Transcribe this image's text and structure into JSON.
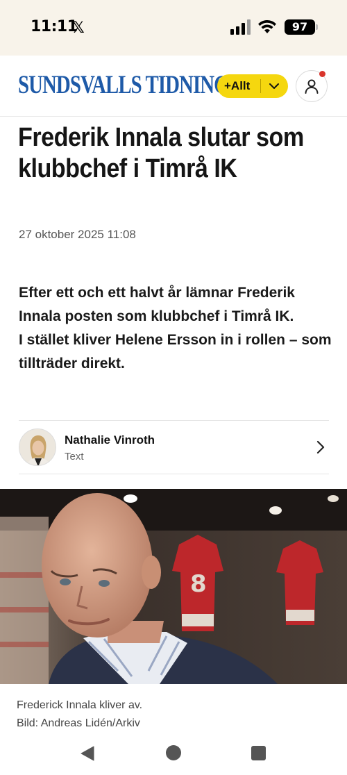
{
  "status_bar": {
    "time": "11:11",
    "x_label": "𝕏",
    "battery": "97",
    "icons": [
      "signal-icon",
      "wifi-icon",
      "battery-icon"
    ]
  },
  "header": {
    "logo": "SUNDSVALLS TIDNING",
    "allt_label": "+Allt",
    "icons": [
      "chevron-down-icon",
      "account-icon"
    ],
    "colors": {
      "brand": "#1e5aa8",
      "accent": "#f5d70f",
      "notification": "#d9342b"
    }
  },
  "article": {
    "headline": "Frederik Innala slutar som klubbchef i Timrå IK",
    "date": "27 oktober 2025 11:08",
    "lead": [
      "Efter ett och ett halvt år lämnar Frederik Innala posten som klubbchef i Timrå IK.",
      "I stället kliver Helene Ersson in i rollen – som tillträder direkt."
    ],
    "author": {
      "name": "Nathalie Vinroth",
      "role": "Text"
    },
    "image": {
      "caption_line1": "Frederick Innala kliver av.",
      "caption_line2": "Bild: Andreas Lidén/Arkiv"
    }
  },
  "navbar": {
    "icons": [
      "back-icon",
      "home-icon",
      "recents-icon"
    ]
  }
}
